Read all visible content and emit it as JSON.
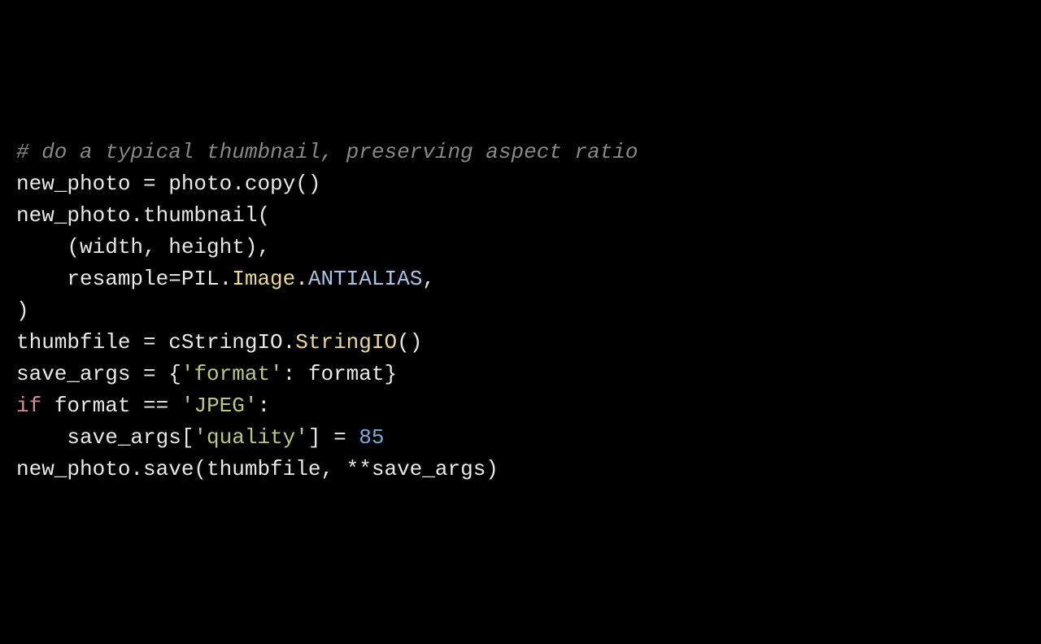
{
  "code": {
    "l1": {
      "comment": "# do a typical thumbnail, preserving aspect ratio"
    },
    "l2": {
      "a": "new_photo = photo.copy()"
    },
    "l3": {
      "a": "new_photo.thumbnail("
    },
    "l4": {
      "a": "    (width, height),"
    },
    "l5": {
      "a": "    resample=PIL.",
      "b": "Image",
      "c": ".",
      "d": "ANTIALIAS",
      "e": ","
    },
    "l6": {
      "a": ")"
    },
    "l7": {
      "a": "thumbfile = cStringIO.",
      "b": "StringIO",
      "c": "()"
    },
    "l8": {
      "a": "save_args = {",
      "b": "'format'",
      "c": ": format}"
    },
    "l9": {
      "a": "if",
      "b": " format == ",
      "c": "'JPEG'",
      "d": ":"
    },
    "l10": {
      "a": "    save_args[",
      "b": "'quality'",
      "c": "] = ",
      "d": "85"
    },
    "l11": {
      "a": "new_photo.save(thumbfile, **save_args)"
    }
  }
}
